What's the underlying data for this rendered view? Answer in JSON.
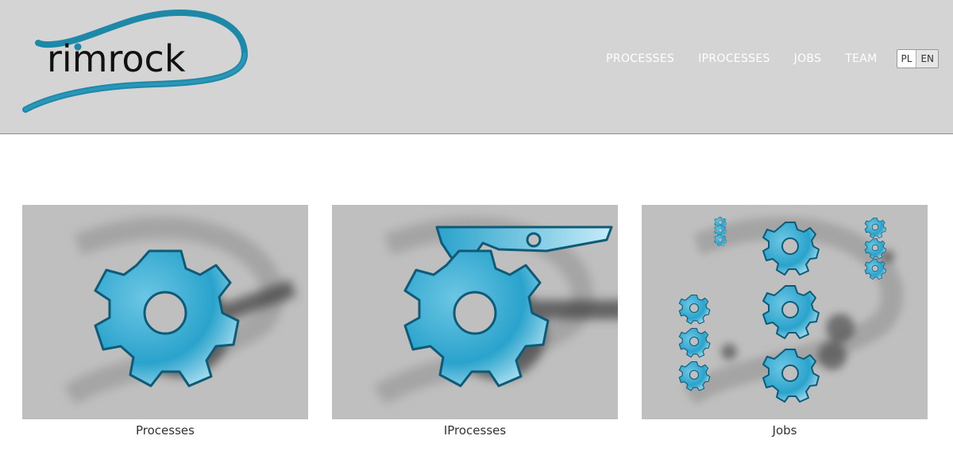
{
  "brand": {
    "logo_text": "rimrock"
  },
  "nav": {
    "items": [
      {
        "label": "PROCESSES"
      },
      {
        "label": "IPROCESSES"
      },
      {
        "label": "JOBS"
      },
      {
        "label": "TEAM"
      }
    ],
    "languages": [
      "PL",
      "EN"
    ]
  },
  "cards": [
    {
      "caption": "Processes",
      "icon": "gear-icon"
    },
    {
      "caption": "IProcesses",
      "icon": "gear-with-arm-icon"
    },
    {
      "caption": "Jobs",
      "icon": "multiple-gears-icon"
    }
  ],
  "colors": {
    "header_bg": "#d4d4d4",
    "accent": "#1e88a8",
    "gear_fill": "#3eb0d4"
  }
}
